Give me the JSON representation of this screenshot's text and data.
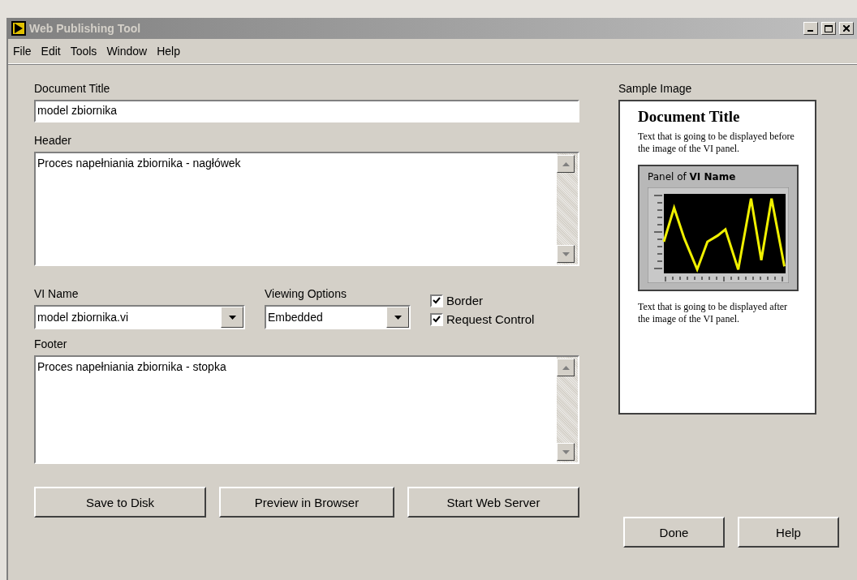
{
  "window": {
    "title": "Web Publishing Tool"
  },
  "menu": [
    {
      "label": "File"
    },
    {
      "label": "Edit"
    },
    {
      "label": "Tools"
    },
    {
      "label": "Window"
    },
    {
      "label": "Help"
    }
  ],
  "document_title": {
    "label": "Document Title",
    "value": "model zbiornika"
  },
  "header": {
    "label": "Header",
    "value": "Proces napełniania zbiornika - nagłówek"
  },
  "vi_name": {
    "label": "VI Name",
    "value": "model zbiornika.vi"
  },
  "viewing_options": {
    "label": "Viewing Options",
    "value": "Embedded"
  },
  "checkboxes": [
    {
      "label": "Border",
      "checked": true
    },
    {
      "label": "Request Control",
      "checked": true
    }
  ],
  "footer": {
    "label": "Footer",
    "value": "Proces napełniania zbiornika - stopka"
  },
  "sample": {
    "label": "Sample Image",
    "title": "Document Title",
    "before": "Text that is going to be displayed before the image of the VI panel.",
    "panel_title": "Panel of **VI Name**",
    "after": "Text that is going to be displayed after the image of the VI panel."
  },
  "buttons": [
    {
      "label": "Save to Disk"
    },
    {
      "label": "Preview in Browser"
    },
    {
      "label": "Start Web Server"
    }
  ],
  "dialog_buttons": [
    {
      "label": "Done"
    },
    {
      "label": "Help"
    }
  ]
}
